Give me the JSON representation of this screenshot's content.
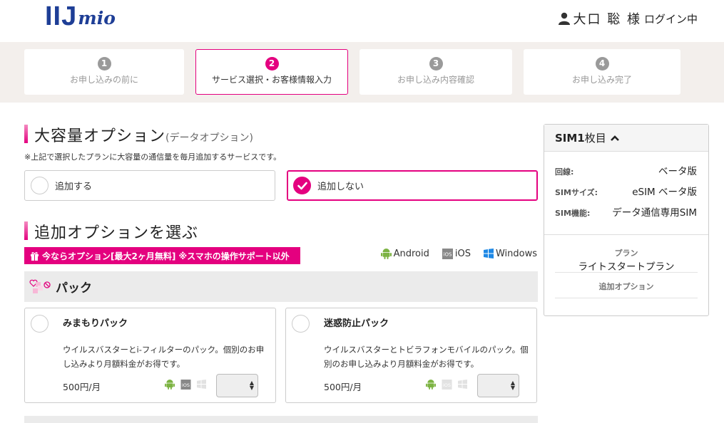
{
  "header": {
    "logo_iij": "IIJ",
    "logo_mio": "mio",
    "user_name": "大口 聡 様",
    "login_status": "ログイン中"
  },
  "steps": [
    {
      "num": "1",
      "label": "お申し込みの前に"
    },
    {
      "num": "2",
      "label": "サービス選択・お客様情報入力"
    },
    {
      "num": "3",
      "label": "お申し込み内容確認"
    },
    {
      "num": "4",
      "label": "お申し込み完了"
    }
  ],
  "large_option": {
    "title": "大容量オプション",
    "subtitle": "(データオプション)",
    "note": "※上記で選択したプランに大容量の通信量を毎月追加するサービスです。",
    "add_label": "追加する",
    "no_add_label": "追加しない",
    "selected": "no_add"
  },
  "additional": {
    "title": "追加オプションを選ぶ",
    "promo": "今ならオプション[最大2ヶ月無料] ※スマホの操作サポート以外",
    "os_android": "Android",
    "os_ios": "iOS",
    "os_windows": "Windows",
    "pack_title": "パック",
    "cards": [
      {
        "name": "みまもりパック",
        "desc": "ウイルスバスターとi-フィルターのパック。個別のお申し込みより月額料金がお得です。",
        "price": "500円/月",
        "android": true,
        "ios": true,
        "windows": false
      },
      {
        "name": "迷惑防止パック",
        "desc": "ウイルスバスターとトビラフォンモバイルのパック。個別のお申し込みより月額料金がお得です。",
        "price": "500円/月",
        "android": true,
        "ios": false,
        "windows": false
      }
    ]
  },
  "sidebar": {
    "sim_title_bold": "SIM1",
    "sim_title_rest": "枚目",
    "rows": [
      {
        "key": "回線:",
        "value": "ベータ版"
      },
      {
        "key": "SIMサイズ:",
        "value": "eSIM ベータ版"
      },
      {
        "key": "SIM機能:",
        "value": "データ通信専用SIM"
      }
    ],
    "plan_label": "プラン",
    "plan_value": "ライトスタートプラン",
    "options_label": "追加オプション"
  },
  "colors": {
    "accent": "#e4007f",
    "brand": "#1e3e96",
    "android": "#7cb342",
    "windows": "#1e88e5"
  }
}
